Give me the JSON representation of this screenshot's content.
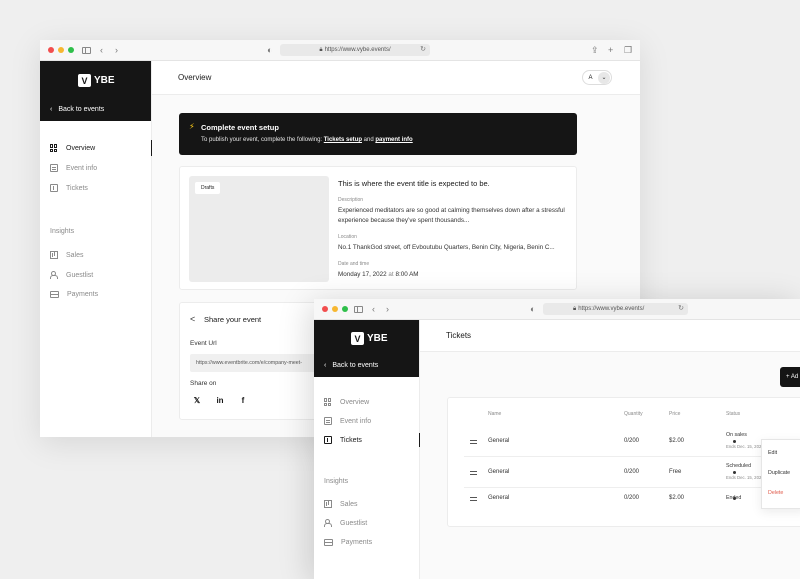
{
  "colors": {
    "dark": "#151515",
    "accent_bolt": "#f5c518",
    "danger": "#e05a4a",
    "bg": "#efefef"
  },
  "browser": {
    "url": "https://www.vybe.events/",
    "icons": [
      "sidebar-icon",
      "back-arrow-icon",
      "forward-arrow-icon",
      "shield-icon",
      "lock-icon",
      "reload-icon",
      "share-icon",
      "new-tab-icon",
      "tabs-icon"
    ]
  },
  "brand": {
    "logo_mark": "V",
    "logo_text": "YBE"
  },
  "sidebar": {
    "back_label": "Back to events",
    "items": [
      {
        "label": "Overview",
        "icon": "grid-icon"
      },
      {
        "label": "Event info",
        "icon": "document-icon"
      },
      {
        "label": "Tickets",
        "icon": "ticket-icon"
      }
    ],
    "insights_label": "Insights",
    "insights": [
      {
        "label": "Sales",
        "icon": "chart-icon"
      },
      {
        "label": "Guestlist",
        "icon": "people-icon"
      },
      {
        "label": "Payments",
        "icon": "card-icon"
      }
    ]
  },
  "overview": {
    "title": "Overview",
    "avatar": "A",
    "alert": {
      "title": "Complete event setup",
      "text_prefix": "To publish your event, complete the following: ",
      "link1": "Tickets setup",
      "and": " and ",
      "link2": "payment info"
    },
    "event": {
      "badge": "Drafts",
      "title": "This is where the event title is expected to be.",
      "desc_label": "Description",
      "desc": "Experienced meditators are so good at calming themselves down after a stressful experience because they’ve spent thousands...",
      "loc_label": "Location",
      "loc": "No.1 ThankGod street, off Evboutubu Quarters, Benin City, Nigeria, Benin C...",
      "date_label": "Date and time",
      "date": "Monday 17, 2022",
      "date_at": " at ",
      "time": "8:00 AM"
    },
    "share": {
      "title": "Share your event",
      "url_label": "Event Url",
      "url": "https://www.eventbrite.com/e/company-meet-",
      "share_on": "Share on",
      "socials": [
        {
          "glyph": "𝕏",
          "icon": "twitter-icon"
        },
        {
          "glyph": "in",
          "icon": "linkedin-icon"
        },
        {
          "glyph": "f",
          "icon": "facebook-icon"
        }
      ]
    }
  },
  "tickets": {
    "title": "Tickets",
    "add_button": "+ Ad",
    "headers": {
      "name": "Name",
      "quantity": "Quantity",
      "price": "Price",
      "status": "Status"
    },
    "rows": [
      {
        "name": "General",
        "quantity": "0/200",
        "price": "$2.00",
        "status": "On sales",
        "sub": "Ends Dec. 15, 202"
      },
      {
        "name": "General",
        "quantity": "0/200",
        "price": "Free",
        "status": "Scheduled",
        "sub": "Ends Dec. 15, 202"
      },
      {
        "name": "General",
        "quantity": "0/200",
        "price": "$2.00",
        "status": "Ended",
        "sub": ""
      }
    ],
    "menu": {
      "edit": "Edit",
      "duplicate": "Duplicate",
      "delete": "Delete"
    }
  }
}
